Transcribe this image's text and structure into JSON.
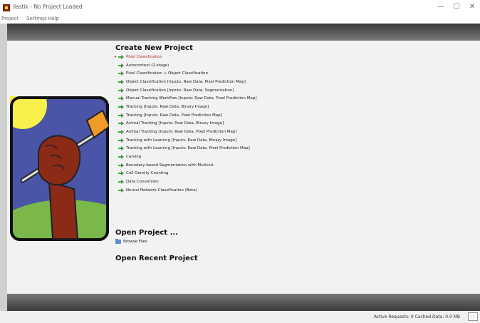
{
  "window": {
    "title": "ilastik - No Project Loaded",
    "minimize_glyph": "—",
    "maximize_glyph": "☐",
    "close_glyph": "✕"
  },
  "menu": [
    "Project",
    "Settings",
    "Help"
  ],
  "create_section": {
    "heading": "Create New Project",
    "workflows": [
      "Pixel Classification",
      "Autocontext (2-stage)",
      "Pixel Classification + Object Classification",
      "Object Classification [Inputs: Raw Data, Pixel Prediction Map]",
      "Object Classification [Inputs: Raw Data, Segmentation]",
      "Manual Tracking Workflow [Inputs: Raw Data, Pixel Prediction Map]",
      "Tracking [Inputs: Raw Data, Binary Image]",
      "Tracking [Inputs: Raw Data, Pixel Prediction Map]",
      "Animal Tracking [Inputs: Raw Data, Binary Image]",
      "Animal Tracking [Inputs: Raw Data, Pixel Prediction Map]",
      "Tracking with Learning [Inputs: Raw Data, Binary Image]",
      "Tracking with Learning [Inputs: Raw Data, Pixel Prediction Map]",
      "Carving",
      "Boundary-based Segmentation with Multicut",
      "Cell Density Counting",
      "Data Conversion",
      "Neural Network Classification (Beta)"
    ]
  },
  "open_section": {
    "heading": "Open Project ...",
    "browse_label": "Browse Files"
  },
  "recent_section": {
    "heading": "Open Recent Project"
  },
  "status": {
    "text": "Active Requests: 0  Cached Data: 0.0 MB",
    "button_label": "..."
  },
  "colors": {
    "accent_arrow": "#3a9a3a",
    "frame_dark": "#3a3a3a",
    "logo_sky": "#4a55a8",
    "logo_grass": "#7ab84a",
    "logo_arm": "#8b2a16",
    "logo_sun": "#f7f04a"
  },
  "icons": {
    "workflow": "green-arrow-icon",
    "browse": "folder-icon",
    "app": "ilastik-app-icon"
  }
}
